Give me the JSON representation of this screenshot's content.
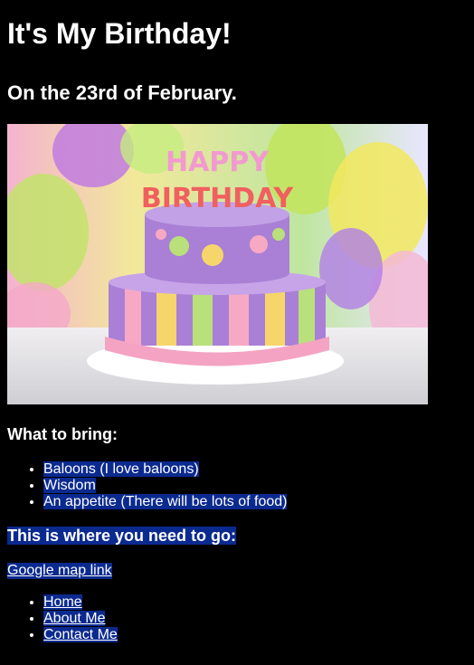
{
  "page": {
    "title": "It's My Birthday!",
    "subtitle": "On the 23rd of February.",
    "highlight_color": "#0b2a8f",
    "background": "#000000"
  },
  "hero_image": {
    "alt_text": "HAPPY BIRTHDAY",
    "icon": "birthday-cake-image"
  },
  "bring": {
    "heading": "What to bring:",
    "items": [
      "Baloons (I love baloons)",
      "Wisdom",
      "An appetite (There will be lots of food)"
    ]
  },
  "location": {
    "heading": "This is where you need to go:",
    "map_link": "Google map link"
  },
  "nav": {
    "items": [
      "Home",
      "About Me",
      "Contact Me"
    ]
  }
}
